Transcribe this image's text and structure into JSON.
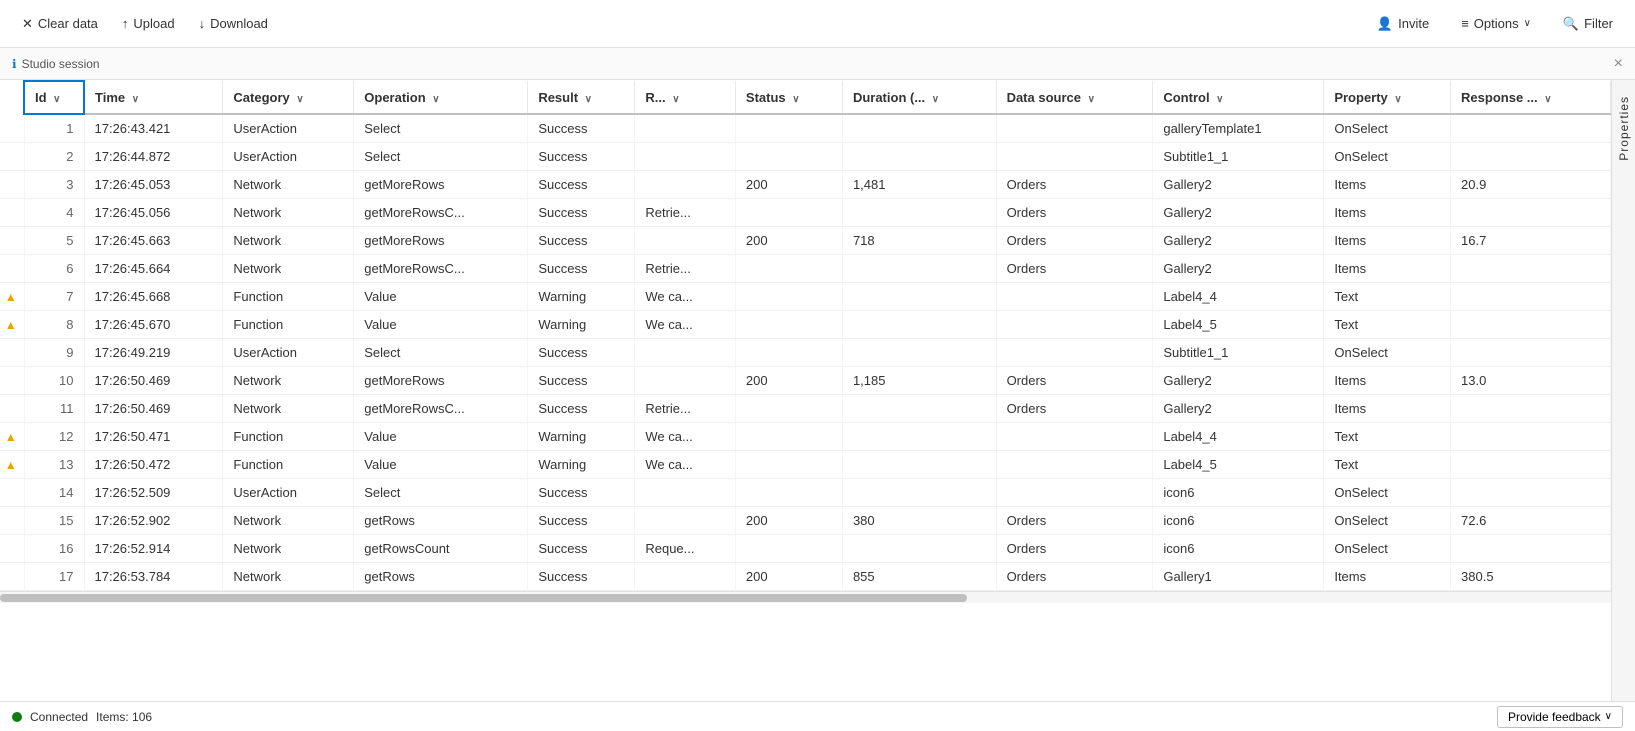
{
  "toolbar": {
    "clear_data_label": "Clear data",
    "upload_label": "Upload",
    "download_label": "Download",
    "invite_label": "Invite",
    "options_label": "Options",
    "filter_label": "Filter"
  },
  "session": {
    "label": "Studio session",
    "close_label": "×"
  },
  "side_panel": {
    "label": "Properties"
  },
  "table": {
    "columns": [
      {
        "key": "id",
        "label": "Id",
        "sortable": true
      },
      {
        "key": "time",
        "label": "Time",
        "sortable": true
      },
      {
        "key": "category",
        "label": "Category",
        "sortable": true
      },
      {
        "key": "operation",
        "label": "Operation",
        "sortable": true
      },
      {
        "key": "result",
        "label": "Result",
        "sortable": true
      },
      {
        "key": "r",
        "label": "R...",
        "sortable": true
      },
      {
        "key": "status",
        "label": "Status",
        "sortable": true
      },
      {
        "key": "duration",
        "label": "Duration (...",
        "sortable": true
      },
      {
        "key": "datasource",
        "label": "Data source",
        "sortable": true
      },
      {
        "key": "control",
        "label": "Control",
        "sortable": true
      },
      {
        "key": "property",
        "label": "Property",
        "sortable": true
      },
      {
        "key": "response",
        "label": "Response ...",
        "sortable": true
      }
    ],
    "rows": [
      {
        "id": 1,
        "warning": false,
        "time": "17:26:43.421",
        "category": "UserAction",
        "operation": "Select",
        "result": "Success",
        "r": "",
        "status": "",
        "duration": "",
        "datasource": "",
        "control": "galleryTemplate1",
        "property": "OnSelect",
        "response": ""
      },
      {
        "id": 2,
        "warning": false,
        "time": "17:26:44.872",
        "category": "UserAction",
        "operation": "Select",
        "result": "Success",
        "r": "",
        "status": "",
        "duration": "",
        "datasource": "",
        "control": "Subtitle1_1",
        "property": "OnSelect",
        "response": ""
      },
      {
        "id": 3,
        "warning": false,
        "time": "17:26:45.053",
        "category": "Network",
        "operation": "getMoreRows",
        "result": "Success",
        "r": "",
        "status": "200",
        "duration": "1,481",
        "datasource": "Orders",
        "control": "Gallery2",
        "property": "Items",
        "response": "20.9"
      },
      {
        "id": 4,
        "warning": false,
        "time": "17:26:45.056",
        "category": "Network",
        "operation": "getMoreRowsC...",
        "result": "Success",
        "r": "Retrie...",
        "status": "",
        "duration": "",
        "datasource": "Orders",
        "control": "Gallery2",
        "property": "Items",
        "response": ""
      },
      {
        "id": 5,
        "warning": false,
        "time": "17:26:45.663",
        "category": "Network",
        "operation": "getMoreRows",
        "result": "Success",
        "r": "",
        "status": "200",
        "duration": "718",
        "datasource": "Orders",
        "control": "Gallery2",
        "property": "Items",
        "response": "16.7"
      },
      {
        "id": 6,
        "warning": false,
        "time": "17:26:45.664",
        "category": "Network",
        "operation": "getMoreRowsC...",
        "result": "Success",
        "r": "Retrie...",
        "status": "",
        "duration": "",
        "datasource": "Orders",
        "control": "Gallery2",
        "property": "Items",
        "response": ""
      },
      {
        "id": 7,
        "warning": true,
        "time": "17:26:45.668",
        "category": "Function",
        "operation": "Value",
        "result": "Warning",
        "r": "We ca...",
        "status": "",
        "duration": "",
        "datasource": "",
        "control": "Label4_4",
        "property": "Text",
        "response": ""
      },
      {
        "id": 8,
        "warning": true,
        "time": "17:26:45.670",
        "category": "Function",
        "operation": "Value",
        "result": "Warning",
        "r": "We ca...",
        "status": "",
        "duration": "",
        "datasource": "",
        "control": "Label4_5",
        "property": "Text",
        "response": ""
      },
      {
        "id": 9,
        "warning": false,
        "time": "17:26:49.219",
        "category": "UserAction",
        "operation": "Select",
        "result": "Success",
        "r": "",
        "status": "",
        "duration": "",
        "datasource": "",
        "control": "Subtitle1_1",
        "property": "OnSelect",
        "response": ""
      },
      {
        "id": 10,
        "warning": false,
        "time": "17:26:50.469",
        "category": "Network",
        "operation": "getMoreRows",
        "result": "Success",
        "r": "",
        "status": "200",
        "duration": "1,185",
        "datasource": "Orders",
        "control": "Gallery2",
        "property": "Items",
        "response": "13.0"
      },
      {
        "id": 11,
        "warning": false,
        "time": "17:26:50.469",
        "category": "Network",
        "operation": "getMoreRowsC...",
        "result": "Success",
        "r": "Retrie...",
        "status": "",
        "duration": "",
        "datasource": "Orders",
        "control": "Gallery2",
        "property": "Items",
        "response": ""
      },
      {
        "id": 12,
        "warning": true,
        "time": "17:26:50.471",
        "category": "Function",
        "operation": "Value",
        "result": "Warning",
        "r": "We ca...",
        "status": "",
        "duration": "",
        "datasource": "",
        "control": "Label4_4",
        "property": "Text",
        "response": ""
      },
      {
        "id": 13,
        "warning": true,
        "time": "17:26:50.472",
        "category": "Function",
        "operation": "Value",
        "result": "Warning",
        "r": "We ca...",
        "status": "",
        "duration": "",
        "datasource": "",
        "control": "Label4_5",
        "property": "Text",
        "response": ""
      },
      {
        "id": 14,
        "warning": false,
        "time": "17:26:52.509",
        "category": "UserAction",
        "operation": "Select",
        "result": "Success",
        "r": "",
        "status": "",
        "duration": "",
        "datasource": "",
        "control": "icon6",
        "property": "OnSelect",
        "response": ""
      },
      {
        "id": 15,
        "warning": false,
        "time": "17:26:52.902",
        "category": "Network",
        "operation": "getRows",
        "result": "Success",
        "r": "",
        "status": "200",
        "duration": "380",
        "datasource": "Orders",
        "control": "icon6",
        "property": "OnSelect",
        "response": "72.6"
      },
      {
        "id": 16,
        "warning": false,
        "time": "17:26:52.914",
        "category": "Network",
        "operation": "getRowsCount",
        "result": "Success",
        "r": "Reque...",
        "status": "",
        "duration": "",
        "datasource": "Orders",
        "control": "icon6",
        "property": "OnSelect",
        "response": ""
      },
      {
        "id": 17,
        "warning": false,
        "time": "17:26:53.784",
        "category": "Network",
        "operation": "getRows",
        "result": "Success",
        "r": "",
        "status": "200",
        "duration": "855",
        "datasource": "Orders",
        "control": "Gallery1",
        "property": "Items",
        "response": "380.5"
      }
    ]
  },
  "status": {
    "connected_label": "Connected",
    "items_label": "Items: 106",
    "feedback_label": "Provide feedback"
  },
  "icons": {
    "clear": "✕",
    "upload": "↑",
    "download": "↓",
    "invite": "👤",
    "options": "≡",
    "filter": "🔍",
    "warning": "▲",
    "info": "ℹ",
    "chevron_down": "∨",
    "close": "✕"
  }
}
